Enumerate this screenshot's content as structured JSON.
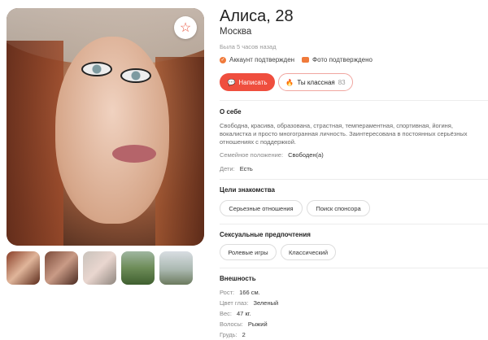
{
  "profile": {
    "name_age": "Алиса, 28",
    "city": "Москва",
    "last_seen": "Была 5 часов назад",
    "verified_account": "Аккаунт подтвержден",
    "verified_photo": "Фото подтверждено"
  },
  "actions": {
    "write_label": "Написать",
    "like_label": "Ты классная",
    "like_count": "83"
  },
  "about": {
    "title": "О себе",
    "text": "Свободна, красива, образована, страстная, темпераментная, спортивная, йогиня, вокалистка и просто многогранная личность. Заинтересована в постоянных серьёзных отношениях с поддержкой.",
    "marital_label": "Семейное положение:",
    "marital_value": "Свободен(а)",
    "kids_label": "Дети:",
    "kids_value": "Есть"
  },
  "goals": {
    "title": "Цели знакомства",
    "items": [
      "Серьезные отношения",
      "Поиск спонсора"
    ]
  },
  "preferences": {
    "title": "Сексуальные предпочтения",
    "items": [
      "Ролевые игры",
      "Классический"
    ]
  },
  "appearance": {
    "title": "Внешность",
    "rows": [
      {
        "label": "Рост:",
        "value": "166 см."
      },
      {
        "label": "Цвет глаз:",
        "value": "Зеленый"
      },
      {
        "label": "Вес:",
        "value": "47 кг."
      },
      {
        "label": "Волосы:",
        "value": "Рыжий"
      },
      {
        "label": "Грудь:",
        "value": "2"
      }
    ]
  },
  "icons": {
    "favorite": "star-outline-icon",
    "write": "chat-bubble-icon",
    "like": "flame-icon",
    "verified": "check-circle-icon",
    "photo_verified": "camera-icon"
  },
  "colors": {
    "accent": "#ef4e3e",
    "verify": "#f07a3b"
  }
}
